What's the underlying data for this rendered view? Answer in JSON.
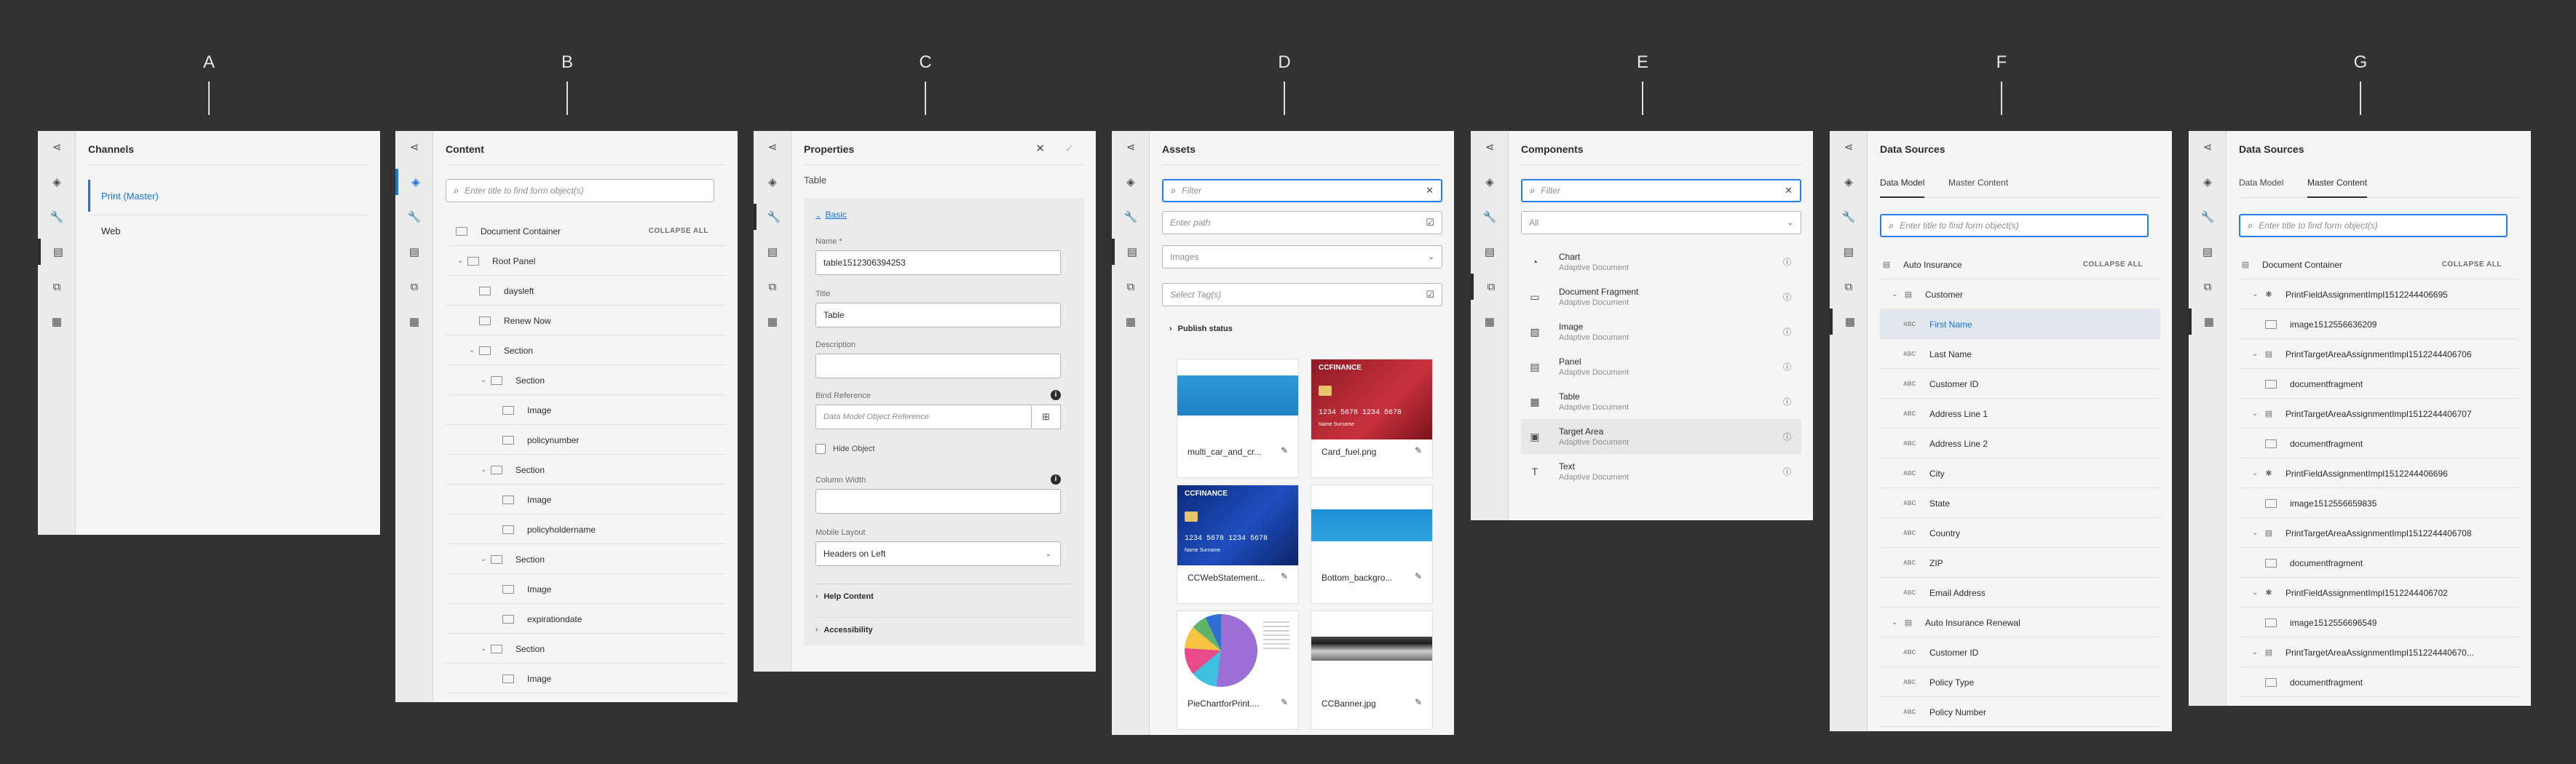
{
  "columns": [
    "A",
    "B",
    "C",
    "D",
    "E",
    "F",
    "G"
  ],
  "panelA": {
    "title": "Channels",
    "items": [
      "Print (Master)",
      "Web"
    ]
  },
  "panelB": {
    "title": "Content",
    "search_placeholder": "Enter title to find form object(s)",
    "collapse_all": "COLLAPSE ALL",
    "rows": [
      {
        "label": "Document Container",
        "indent": 0,
        "chevron": false
      },
      {
        "label": "Root Panel",
        "indent": 1,
        "chevron": true
      },
      {
        "label": "daysleft",
        "indent": 2,
        "chevron": false
      },
      {
        "label": "Renew Now",
        "indent": 2,
        "chevron": false
      },
      {
        "label": "Section",
        "indent": 2,
        "chevron": true
      },
      {
        "label": "Section",
        "indent": 3,
        "chevron": true
      },
      {
        "label": "Image",
        "indent": 4,
        "chevron": false
      },
      {
        "label": "policynumber",
        "indent": 4,
        "chevron": false
      },
      {
        "label": "Section",
        "indent": 3,
        "chevron": true
      },
      {
        "label": "Image",
        "indent": 4,
        "chevron": false
      },
      {
        "label": "policyholdername",
        "indent": 4,
        "chevron": false
      },
      {
        "label": "Section",
        "indent": 3,
        "chevron": true
      },
      {
        "label": "Image",
        "indent": 4,
        "chevron": false
      },
      {
        "label": "expirationdate",
        "indent": 4,
        "chevron": false
      },
      {
        "label": "Section",
        "indent": 3,
        "chevron": true
      },
      {
        "label": "Image",
        "indent": 4,
        "chevron": false
      }
    ]
  },
  "panelC": {
    "title": "Properties",
    "subtitle": "Table",
    "section_basic": "Basic",
    "name_label": "Name *",
    "name_value": "table1512306394253",
    "title_label": "Title",
    "title_value": "Table",
    "description_label": "Description",
    "bind_label": "Bind Reference",
    "bind_placeholder": "Data Model Object Reference",
    "hide_object": "Hide Object",
    "column_width_label": "Column Width",
    "mobile_layout_label": "Mobile Layout",
    "mobile_layout_value": "Headers on Left",
    "help_content": "Help Content",
    "accessibility": "Accessibility"
  },
  "panelD": {
    "title": "Assets",
    "filter_placeholder": "Filter",
    "path_placeholder": "Enter path",
    "type_value": "Images",
    "tags_placeholder": "Select Tag(s)",
    "publish_status": "Publish status",
    "cards": [
      {
        "name": "multi_car_and_cr...",
        "thumb": "banner-blue"
      },
      {
        "name": "Card_fuel.png",
        "thumb": "card-red"
      },
      {
        "name": "CCWebStatement...",
        "thumb": "card-blue"
      },
      {
        "name": "Bottom_backgro...",
        "thumb": "bottom-blue"
      },
      {
        "name": "PieChartforPrint....",
        "thumb": "pie"
      },
      {
        "name": "CCBanner.jpg",
        "thumb": "banner-gray"
      }
    ],
    "card_text": {
      "brand": "CCFINANCE",
      "number": "1234 5678 1234 5678",
      "holder": "Name Surname"
    }
  },
  "panelE": {
    "title": "Components",
    "filter_placeholder": "Filter",
    "type_value": "All",
    "items": [
      {
        "name": "Chart",
        "sub": "Adaptive Document",
        "icon": "chart-icon"
      },
      {
        "name": "Document Fragment",
        "sub": "Adaptive Document",
        "icon": "fragment-icon"
      },
      {
        "name": "Image",
        "sub": "Adaptive Document",
        "icon": "image-icon"
      },
      {
        "name": "Panel",
        "sub": "Adaptive Document",
        "icon": "panel-icon"
      },
      {
        "name": "Table",
        "sub": "Adaptive Document",
        "icon": "table-icon"
      },
      {
        "name": "Target Area",
        "sub": "Adaptive Document",
        "icon": "target-area-icon"
      },
      {
        "name": "Text",
        "sub": "Adaptive Document",
        "icon": "text-icon"
      }
    ]
  },
  "panelF": {
    "title": "Data Sources",
    "tabs": [
      "Data Model",
      "Master Content"
    ],
    "search_placeholder": "Enter title to find form object(s)",
    "collapse_all": "COLLAPSE ALL",
    "rows": [
      {
        "label": "Auto Insurance",
        "kind": "model",
        "indent": 0
      },
      {
        "label": "Customer",
        "kind": "group",
        "indent": 1
      },
      {
        "label": "First Name",
        "kind": "abc",
        "indent": 2,
        "sel": true
      },
      {
        "label": "Last Name",
        "kind": "abc",
        "indent": 2
      },
      {
        "label": "Customer ID",
        "kind": "abc",
        "indent": 2
      },
      {
        "label": "Address Line 1",
        "kind": "abc",
        "indent": 2
      },
      {
        "label": "Address Line 2",
        "kind": "abc",
        "indent": 2
      },
      {
        "label": "City",
        "kind": "abc",
        "indent": 2
      },
      {
        "label": "State",
        "kind": "abc",
        "indent": 2
      },
      {
        "label": "Country",
        "kind": "abc",
        "indent": 2
      },
      {
        "label": "ZIP",
        "kind": "abc",
        "indent": 2
      },
      {
        "label": "Email Address",
        "kind": "abc",
        "indent": 2
      },
      {
        "label": "Auto Insurance Renewal",
        "kind": "group",
        "indent": 1
      },
      {
        "label": "Customer ID",
        "kind": "abc",
        "indent": 2
      },
      {
        "label": "Policy Type",
        "kind": "abc",
        "indent": 2
      },
      {
        "label": "Policy Number",
        "kind": "abc",
        "indent": 2
      }
    ],
    "abc": "ABC"
  },
  "panelG": {
    "title": "Data Sources",
    "tabs": [
      "Data Model",
      "Master Content"
    ],
    "search_placeholder": "Enter title to find form object(s)",
    "collapse_all": "COLLAPSE ALL",
    "rows": [
      {
        "label": "Document Container",
        "kind": "doc",
        "indent": 0
      },
      {
        "label": "PrintFieldAssignmentImpl1512244406695",
        "kind": "field",
        "indent": 1
      },
      {
        "label": "image1512556636209",
        "kind": "img",
        "indent": 2
      },
      {
        "label": "PrintTargetAreaAssignmentImpl1512244406706",
        "kind": "target",
        "indent": 1
      },
      {
        "label": "documentfragment",
        "kind": "img",
        "indent": 2
      },
      {
        "label": "PrintTargetAreaAssignmentImpl1512244406707",
        "kind": "target",
        "indent": 1
      },
      {
        "label": "documentfragment",
        "kind": "img",
        "indent": 2
      },
      {
        "label": "PrintFieldAssignmentImpl1512244406696",
        "kind": "field",
        "indent": 1
      },
      {
        "label": "image1512556659835",
        "kind": "img",
        "indent": 2
      },
      {
        "label": "PrintTargetAreaAssignmentImpl1512244406708",
        "kind": "target",
        "indent": 1
      },
      {
        "label": "documentfragment",
        "kind": "img",
        "indent": 2
      },
      {
        "label": "PrintFieldAssignmentImpl1512244406702",
        "kind": "field",
        "indent": 1
      },
      {
        "label": "image1512556696549",
        "kind": "img",
        "indent": 2
      },
      {
        "label": "PrintTargetAreaAssignmentImpl151224440670...",
        "kind": "target",
        "indent": 1
      },
      {
        "label": "documentfragment",
        "kind": "img",
        "indent": 2
      }
    ]
  },
  "colors": {
    "accent": "#1473e6",
    "background": "#323232",
    "panel": "#f5f5f5"
  }
}
